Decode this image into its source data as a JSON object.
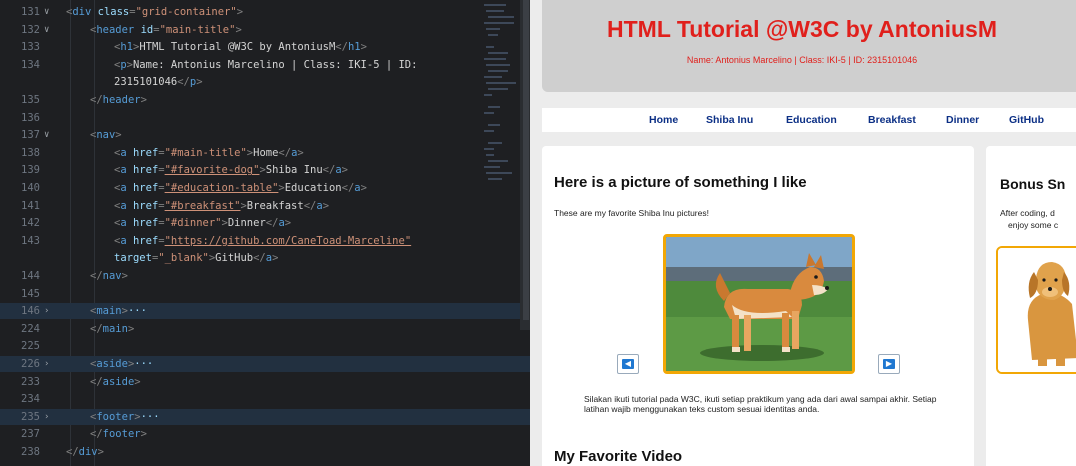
{
  "editor": {
    "lines": [
      {
        "num": "131",
        "chev": "v",
        "indent": 0,
        "fold": false,
        "tokens": [
          [
            "p",
            "<"
          ],
          [
            "tag",
            "div"
          ],
          [
            "t",
            " "
          ],
          [
            "attr",
            "class"
          ],
          [
            "p",
            "="
          ],
          [
            "str",
            "\"grid-container\""
          ],
          [
            "p",
            ">"
          ]
        ]
      },
      {
        "num": "132",
        "chev": "v",
        "indent": 1,
        "fold": false,
        "tokens": [
          [
            "p",
            "<"
          ],
          [
            "tag",
            "header"
          ],
          [
            "t",
            " "
          ],
          [
            "attr",
            "id"
          ],
          [
            "p",
            "="
          ],
          [
            "str",
            "\"main-title\""
          ],
          [
            "p",
            ">"
          ]
        ]
      },
      {
        "num": "133",
        "chev": "",
        "indent": 2,
        "fold": false,
        "tokens": [
          [
            "p",
            "<"
          ],
          [
            "tag",
            "h1"
          ],
          [
            "p",
            ">"
          ],
          [
            "t",
            "HTML Tutorial @W3C by AntoniusM"
          ],
          [
            "p",
            "</"
          ],
          [
            "tag",
            "h1"
          ],
          [
            "p",
            ">"
          ]
        ]
      },
      {
        "num": "134",
        "chev": "",
        "indent": 2,
        "fold": false,
        "tokens": [
          [
            "p",
            "<"
          ],
          [
            "tag",
            "p"
          ],
          [
            "p",
            ">"
          ],
          [
            "t",
            "Name: Antonius Marcelino | Class: IKI-5 | ID:"
          ]
        ]
      },
      {
        "num": "",
        "chev": "",
        "indent": 2,
        "fold": false,
        "tokens": [
          [
            "t",
            "2315101046"
          ],
          [
            "p",
            "</"
          ],
          [
            "tag",
            "p"
          ],
          [
            "p",
            ">"
          ]
        ]
      },
      {
        "num": "135",
        "chev": "",
        "indent": 1,
        "fold": false,
        "tokens": [
          [
            "p",
            "</"
          ],
          [
            "tag",
            "header"
          ],
          [
            "p",
            ">"
          ]
        ]
      },
      {
        "num": "136",
        "chev": "",
        "indent": 0,
        "fold": false,
        "tokens": []
      },
      {
        "num": "137",
        "chev": "v",
        "indent": 1,
        "fold": false,
        "tokens": [
          [
            "p",
            "<"
          ],
          [
            "tag",
            "nav"
          ],
          [
            "p",
            ">"
          ]
        ]
      },
      {
        "num": "138",
        "chev": "",
        "indent": 2,
        "fold": false,
        "tokens": [
          [
            "p",
            "<"
          ],
          [
            "tag",
            "a"
          ],
          [
            "t",
            " "
          ],
          [
            "attr",
            "href"
          ],
          [
            "p",
            "="
          ],
          [
            "str",
            "\"#main-title\""
          ],
          [
            "p",
            ">"
          ],
          [
            "t",
            "Home"
          ],
          [
            "p",
            "</"
          ],
          [
            "tag",
            "a"
          ],
          [
            "p",
            ">"
          ]
        ]
      },
      {
        "num": "139",
        "chev": "",
        "indent": 2,
        "fold": false,
        "tokens": [
          [
            "p",
            "<"
          ],
          [
            "tag",
            "a"
          ],
          [
            "t",
            " "
          ],
          [
            "attr",
            "href"
          ],
          [
            "p",
            "="
          ],
          [
            "link",
            "\"#favorite-dog\""
          ],
          [
            "p",
            ">"
          ],
          [
            "t",
            "Shiba Inu"
          ],
          [
            "p",
            "</"
          ],
          [
            "tag",
            "a"
          ],
          [
            "p",
            ">"
          ]
        ]
      },
      {
        "num": "140",
        "chev": "",
        "indent": 2,
        "fold": false,
        "tokens": [
          [
            "p",
            "<"
          ],
          [
            "tag",
            "a"
          ],
          [
            "t",
            " "
          ],
          [
            "attr",
            "href"
          ],
          [
            "p",
            "="
          ],
          [
            "link",
            "\"#education-table\""
          ],
          [
            "p",
            ">"
          ],
          [
            "t",
            "Education"
          ],
          [
            "p",
            "</"
          ],
          [
            "tag",
            "a"
          ],
          [
            "p",
            ">"
          ]
        ]
      },
      {
        "num": "141",
        "chev": "",
        "indent": 2,
        "fold": false,
        "tokens": [
          [
            "p",
            "<"
          ],
          [
            "tag",
            "a"
          ],
          [
            "t",
            " "
          ],
          [
            "attr",
            "href"
          ],
          [
            "p",
            "="
          ],
          [
            "link",
            "\"#breakfast\""
          ],
          [
            "p",
            ">"
          ],
          [
            "t",
            "Breakfast"
          ],
          [
            "p",
            "</"
          ],
          [
            "tag",
            "a"
          ],
          [
            "p",
            ">"
          ]
        ]
      },
      {
        "num": "142",
        "chev": "",
        "indent": 2,
        "fold": false,
        "tokens": [
          [
            "p",
            "<"
          ],
          [
            "tag",
            "a"
          ],
          [
            "t",
            " "
          ],
          [
            "attr",
            "href"
          ],
          [
            "p",
            "="
          ],
          [
            "str",
            "\"#dinner\""
          ],
          [
            "p",
            ">"
          ],
          [
            "t",
            "Dinner"
          ],
          [
            "p",
            "</"
          ],
          [
            "tag",
            "a"
          ],
          [
            "p",
            ">"
          ]
        ]
      },
      {
        "num": "143",
        "chev": "",
        "indent": 2,
        "fold": false,
        "tokens": [
          [
            "p",
            "<"
          ],
          [
            "tag",
            "a"
          ],
          [
            "t",
            " "
          ],
          [
            "attr",
            "href"
          ],
          [
            "p",
            "="
          ],
          [
            "link",
            "\"https://github.com/CaneToad-Marceline\""
          ]
        ]
      },
      {
        "num": "",
        "chev": "",
        "indent": 2,
        "fold": false,
        "tokens": [
          [
            "attr",
            "target"
          ],
          [
            "p",
            "="
          ],
          [
            "str",
            "\"_blank\""
          ],
          [
            "p",
            ">"
          ],
          [
            "t",
            "GitHub"
          ],
          [
            "p",
            "</"
          ],
          [
            "tag",
            "a"
          ],
          [
            "p",
            ">"
          ]
        ]
      },
      {
        "num": "144",
        "chev": "",
        "indent": 1,
        "fold": false,
        "tokens": [
          [
            "p",
            "</"
          ],
          [
            "tag",
            "nav"
          ],
          [
            "p",
            ">"
          ]
        ]
      },
      {
        "num": "145",
        "chev": "",
        "indent": 0,
        "fold": false,
        "tokens": []
      },
      {
        "num": "146",
        "chev": ">",
        "indent": 1,
        "fold": true,
        "tokens": [
          [
            "p",
            "<"
          ],
          [
            "tag",
            "main"
          ],
          [
            "p",
            ">"
          ],
          [
            "ell",
            "···"
          ]
        ]
      },
      {
        "num": "224",
        "chev": "",
        "indent": 1,
        "fold": false,
        "tokens": [
          [
            "p",
            "</"
          ],
          [
            "tag",
            "main"
          ],
          [
            "p",
            ">"
          ]
        ]
      },
      {
        "num": "225",
        "chev": "",
        "indent": 0,
        "fold": false,
        "tokens": []
      },
      {
        "num": "226",
        "chev": ">",
        "indent": 1,
        "fold": true,
        "tokens": [
          [
            "p",
            "<"
          ],
          [
            "tag",
            "aside"
          ],
          [
            "p",
            ">"
          ],
          [
            "ell",
            "···"
          ]
        ]
      },
      {
        "num": "233",
        "chev": "",
        "indent": 1,
        "fold": false,
        "tokens": [
          [
            "p",
            "</"
          ],
          [
            "tag",
            "aside"
          ],
          [
            "p",
            ">"
          ]
        ]
      },
      {
        "num": "234",
        "chev": "",
        "indent": 0,
        "fold": false,
        "tokens": []
      },
      {
        "num": "235",
        "chev": ">",
        "indent": 1,
        "fold": true,
        "tokens": [
          [
            "p",
            "<"
          ],
          [
            "tag",
            "footer"
          ],
          [
            "p",
            ">"
          ],
          [
            "ell",
            "···"
          ]
        ]
      },
      {
        "num": "237",
        "chev": "",
        "indent": 1,
        "fold": false,
        "tokens": [
          [
            "p",
            "</"
          ],
          [
            "tag",
            "footer"
          ],
          [
            "p",
            ">"
          ]
        ]
      },
      {
        "num": "238",
        "chev": "",
        "indent": 0,
        "fold": false,
        "tokens": [
          [
            "p",
            "</"
          ],
          [
            "tag",
            "div"
          ],
          [
            "p",
            ">"
          ]
        ]
      }
    ]
  },
  "preview": {
    "header": {
      "title": "HTML Tutorial @W3C by AntoniusM",
      "subtitle": "Name: Antonius Marcelino | Class: IKI-5 | ID: 2315101046"
    },
    "nav": [
      "Home",
      "Shiba Inu",
      "Education",
      "Breakfast",
      "Dinner",
      "GitHub"
    ],
    "main": {
      "heading": "Here is a picture of something I like",
      "text": "These are my favorite Shiba Inu pictures!",
      "prev_icon": "arrow-left-icon",
      "next_icon": "arrow-right-icon",
      "instructions": "Silakan ikuti tutorial pada W3C, ikuti setiap praktikum yang ada dari awal sampai akhir. Setiap latihan wajib menggunakan teks custom sesuai identitas anda.",
      "video_heading": "My Favorite Video"
    },
    "aside": {
      "heading": "Bonus Sn",
      "text_line1": "After coding, d",
      "text_line2": "enjoy some c"
    }
  },
  "colors": {
    "title_red": "#e0201c",
    "nav_blue": "#0b2f85",
    "frame_orange": "#f2a705",
    "button_blue": "#1f78d1"
  }
}
